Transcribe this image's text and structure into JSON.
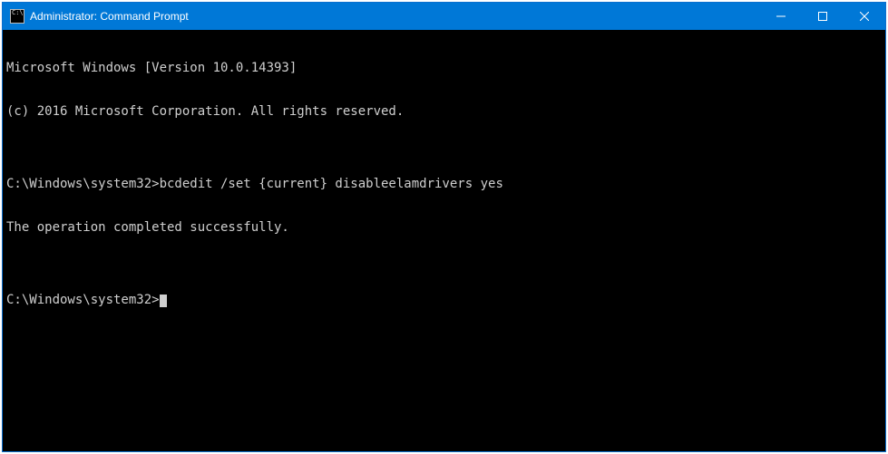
{
  "titlebar": {
    "title": "Administrator: Command Prompt",
    "icon_name": "cmd-icon"
  },
  "console": {
    "lines": [
      "Microsoft Windows [Version 10.0.14393]",
      "(c) 2016 Microsoft Corporation. All rights reserved.",
      "",
      "C:\\Windows\\system32>bcdedit /set {current} disableelamdrivers yes",
      "The operation completed successfully.",
      "",
      "C:\\Windows\\system32>"
    ]
  },
  "colors": {
    "titlebar_bg": "#0078d7",
    "console_bg": "#000000",
    "console_fg": "#cfcfcf"
  }
}
